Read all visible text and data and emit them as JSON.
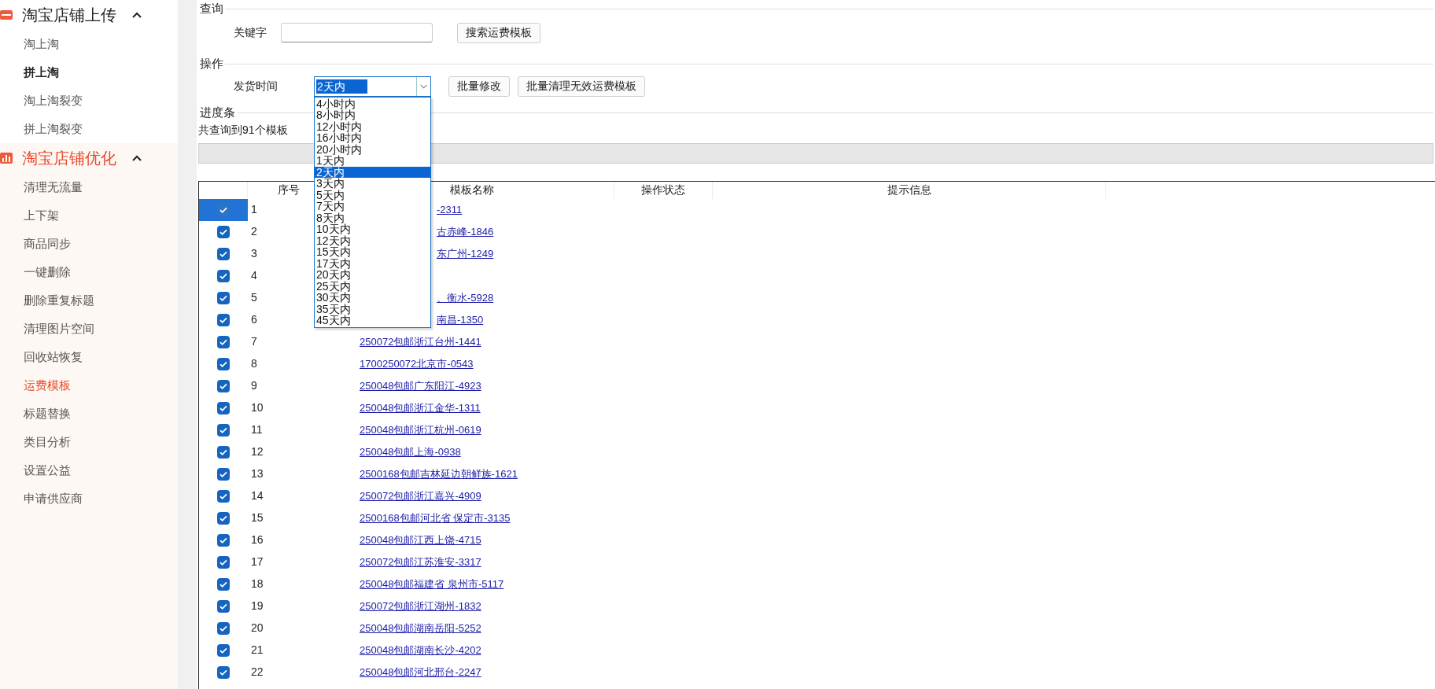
{
  "sidebar": {
    "groups": [
      {
        "title": "淘宝店铺上传",
        "active": false,
        "expanded": true,
        "items": [
          {
            "label": "淘上淘",
            "selected": false,
            "bold": false
          },
          {
            "label": "拼上淘",
            "selected": false,
            "bold": true
          },
          {
            "label": "淘上淘裂变",
            "selected": false,
            "bold": false
          },
          {
            "label": "拼上淘裂变",
            "selected": false,
            "bold": false
          }
        ]
      },
      {
        "title": "淘宝店铺优化",
        "active": true,
        "expanded": true,
        "items": [
          {
            "label": "清理无流量",
            "selected": false,
            "bold": false
          },
          {
            "label": "上下架",
            "selected": false,
            "bold": false
          },
          {
            "label": "商品同步",
            "selected": false,
            "bold": false
          },
          {
            "label": "一键删除",
            "selected": false,
            "bold": false
          },
          {
            "label": "删除重复标题",
            "selected": false,
            "bold": false
          },
          {
            "label": "清理图片空间",
            "selected": false,
            "bold": false
          },
          {
            "label": "回收站恢复",
            "selected": false,
            "bold": false
          },
          {
            "label": "运费模板",
            "selected": true,
            "bold": false
          },
          {
            "label": "标题替换",
            "selected": false,
            "bold": false
          },
          {
            "label": "类目分析",
            "selected": false,
            "bold": false
          },
          {
            "label": "设置公益",
            "selected": false,
            "bold": false
          },
          {
            "label": "申请供应商",
            "selected": false,
            "bold": false
          }
        ]
      }
    ]
  },
  "query": {
    "title": "查询",
    "keyword_label": "关键字",
    "search_button": "搜索运费模板"
  },
  "operation": {
    "title": "操作",
    "time_label": "发货时间",
    "time_value": "2天内",
    "dropdown_open": true,
    "options": [
      {
        "label": "4小时内",
        "selected": false
      },
      {
        "label": "8小时内",
        "selected": false
      },
      {
        "label": "12小时内",
        "selected": false
      },
      {
        "label": "16小时内",
        "selected": false
      },
      {
        "label": "20小时内",
        "selected": false
      },
      {
        "label": "1天内",
        "selected": false
      },
      {
        "label": "2天内",
        "selected": true
      },
      {
        "label": "3天内",
        "selected": false
      },
      {
        "label": "5天内",
        "selected": false
      },
      {
        "label": "7天内",
        "selected": false
      },
      {
        "label": "8天内",
        "selected": false
      },
      {
        "label": "10天内",
        "selected": false
      },
      {
        "label": "12天内",
        "selected": false
      },
      {
        "label": "15天内",
        "selected": false
      },
      {
        "label": "17天内",
        "selected": false
      },
      {
        "label": "20天内",
        "selected": false
      },
      {
        "label": "25天内",
        "selected": false
      },
      {
        "label": "30天内",
        "selected": false
      },
      {
        "label": "35天内",
        "selected": false
      },
      {
        "label": "45天内",
        "selected": false
      }
    ],
    "buttons": [
      "批量修改",
      "批量清理无效运费模板"
    ]
  },
  "progress": {
    "title": "进度条",
    "message": "共查询到91个模板",
    "level": 0
  },
  "table": {
    "columns": [
      "序号",
      "模板名称",
      "操作状态",
      "提示信息"
    ],
    "rows": [
      {
        "checked": true,
        "selected": true,
        "covered": true,
        "index": "1",
        "name": "-2311"
      },
      {
        "checked": true,
        "selected": false,
        "covered": true,
        "index": "2",
        "name": "古赤峰-1846"
      },
      {
        "checked": true,
        "selected": false,
        "covered": true,
        "index": "3",
        "name": "东广州-1249"
      },
      {
        "checked": true,
        "selected": false,
        "index": "4"
      },
      {
        "checked": true,
        "selected": false,
        "covered": true,
        "index": "5",
        "name": "、衡水-5928"
      },
      {
        "checked": true,
        "selected": false,
        "covered": true,
        "index": "6",
        "name": "南昌-1350"
      },
      {
        "checked": true,
        "selected": false,
        "covered": false,
        "index": "7",
        "name": "250072包邮浙江台州-1441"
      },
      {
        "checked": true,
        "selected": false,
        "covered": false,
        "index": "8",
        "name": "1700250072北京市-0543"
      },
      {
        "checked": true,
        "selected": false,
        "covered": false,
        "index": "9",
        "name": "250048包邮广东阳江-4923"
      },
      {
        "checked": true,
        "selected": false,
        "covered": false,
        "index": "10",
        "name": "250048包邮浙江金华-1311"
      },
      {
        "checked": true,
        "selected": false,
        "covered": false,
        "index": "11",
        "name": "250048包邮浙江杭州-0619"
      },
      {
        "checked": true,
        "selected": false,
        "covered": false,
        "index": "12",
        "name": "250048包邮上海-0938"
      },
      {
        "checked": true,
        "selected": false,
        "covered": false,
        "index": "13",
        "name": "2500168包邮吉林延边朝鲜族-1621"
      },
      {
        "checked": true,
        "selected": false,
        "covered": false,
        "index": "14",
        "name": "250072包邮浙江嘉兴-4909"
      },
      {
        "checked": true,
        "selected": false,
        "covered": false,
        "index": "15",
        "name": "2500168包邮河北省 保定市-3135"
      },
      {
        "checked": true,
        "selected": false,
        "covered": false,
        "index": "16",
        "name": "250048包邮江西上饶-4715"
      },
      {
        "checked": true,
        "selected": false,
        "covered": false,
        "index": "17",
        "name": "250072包邮江苏淮安-3317"
      },
      {
        "checked": true,
        "selected": false,
        "covered": false,
        "index": "18",
        "name": "250048包邮福建省 泉州市-5117"
      },
      {
        "checked": true,
        "selected": false,
        "covered": false,
        "index": "19",
        "name": "250072包邮浙江湖州-1832"
      },
      {
        "checked": true,
        "selected": false,
        "covered": false,
        "index": "20",
        "name": "250048包邮湖南岳阳-5252"
      },
      {
        "checked": true,
        "selected": false,
        "covered": false,
        "index": "21",
        "name": "250048包邮湖南长沙-4202"
      },
      {
        "checked": true,
        "selected": false,
        "covered": false,
        "index": "22",
        "name": "250048包邮河北邢台-2247"
      }
    ]
  }
}
